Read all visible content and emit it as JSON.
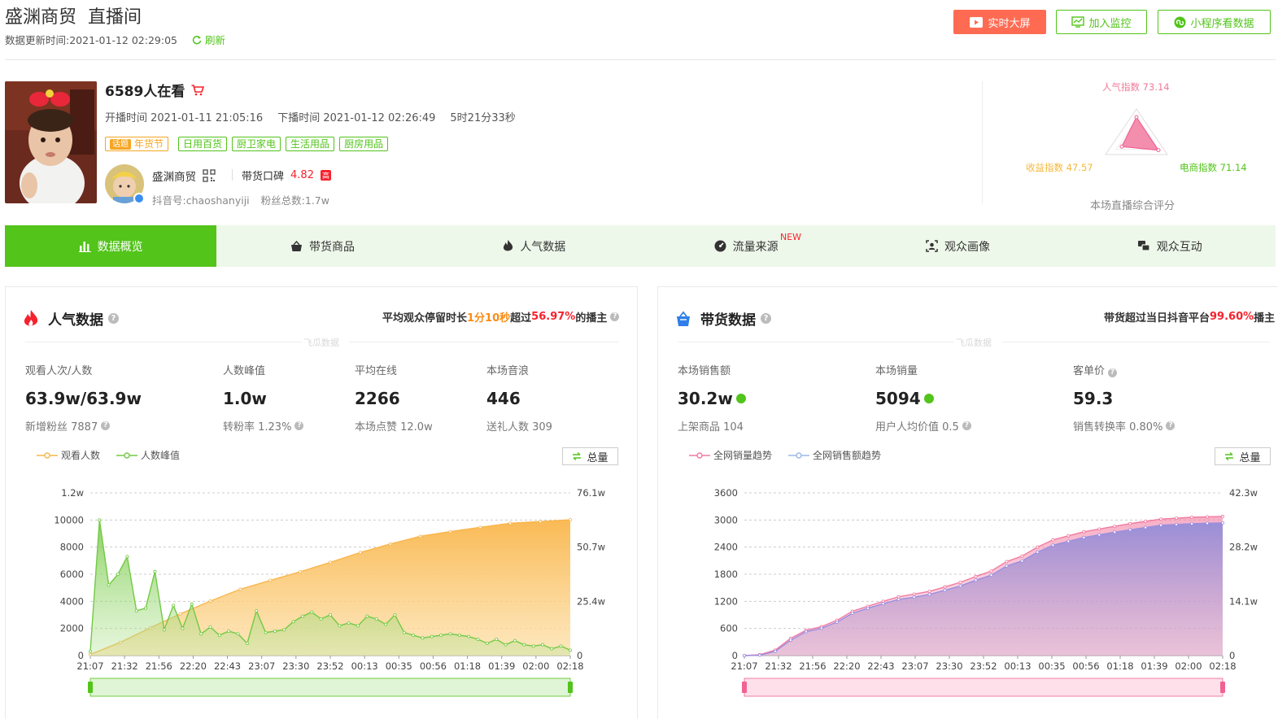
{
  "header": {
    "shop": "盛渊商贸",
    "room": "直播间",
    "update_label": "数据更新时间:",
    "update_time": "2021-01-12 02:29:05",
    "refresh": "刷新",
    "btn_screen": "实时大屏",
    "btn_monitor": "加入监控",
    "btn_mini": "小程序看数据"
  },
  "profile": {
    "viewers": "6589人在看",
    "start": "开播时间 2021-01-11 21:05:16",
    "end": "下播时间 2021-01-12 02:26:49",
    "duration": "5时21分33秒",
    "topic_badge": "话题",
    "topic": "年货节",
    "tags": [
      "日用百货",
      "厨卫家电",
      "生活用品",
      "厨房用品"
    ],
    "shop_name": "盛渊商贸",
    "koubei_label": "带货口碑",
    "koubei_score": "4.82",
    "koubei_level": "高",
    "douyin_id": "抖音号:chaoshanyiji",
    "fans": "粉丝总数:1.7w"
  },
  "radar": {
    "popularity": "人气指数 73.14",
    "income": "收益指数 47.57",
    "ecommerce": "电商指数 71.14",
    "caption": "本场直播综合评分",
    "values": [
      73.14,
      71.14,
      47.57
    ]
  },
  "tabs": [
    {
      "label": "数据概览",
      "icon": "bar-chart-icon"
    },
    {
      "label": "带货商品",
      "icon": "basket-icon"
    },
    {
      "label": "人气数据",
      "icon": "flame-icon"
    },
    {
      "label": "流量来源",
      "icon": "gauge-icon",
      "badge": "NEW"
    },
    {
      "label": "观众画像",
      "icon": "portrait-icon"
    },
    {
      "label": "观众互动",
      "icon": "chat-icon"
    }
  ],
  "popularity_panel": {
    "title": "人气数据",
    "summary_pre": "平均观众停留时长",
    "summary_time": "1分10秒",
    "summary_mid": " 超过",
    "summary_pct": "56.97%",
    "summary_post": "的播主",
    "watermark": "飞瓜数据",
    "metrics": [
      {
        "label": "观看人次/人数",
        "value": "63.9w/63.9w",
        "sub": "新增粉丝 7887"
      },
      {
        "label": "人数峰值",
        "value": "1.0w",
        "sub": "转粉率 1.23%"
      },
      {
        "label": "平均在线",
        "value": "2266",
        "sub": "本场点赞 12.0w"
      },
      {
        "label": "本场音浪",
        "value": "446",
        "sub": "送礼人数 309"
      }
    ],
    "legend": [
      "观看人数",
      "人数峰值"
    ],
    "total_btn": "总量"
  },
  "sales_panel": {
    "title": "带货数据",
    "summary_pre": "带货超过当日抖音平台",
    "summary_pct": "99.60%",
    "summary_post": "播主",
    "watermark": "飞瓜数据",
    "metrics": [
      {
        "label": "本场销售额",
        "value": "30.2w",
        "sub": "上架商品 104"
      },
      {
        "label": "本场销量",
        "value": "5094",
        "sub": "用户人均价值 0.5"
      },
      {
        "label": "客单价",
        "value": "59.3",
        "sub": "销售转换率 0.80%"
      }
    ],
    "legend": [
      "全网销量趋势",
      "全网销售额趋势"
    ],
    "total_btn": "总量"
  },
  "chart_data": [
    {
      "type": "area",
      "x": [
        "21:07",
        "21:32",
        "21:56",
        "22:20",
        "22:43",
        "23:07",
        "23:30",
        "23:52",
        "00:13",
        "00:35",
        "00:56",
        "01:18",
        "01:39",
        "02:00",
        "02:18"
      ],
      "y_left_ticks": [
        "0",
        "2000",
        "4000",
        "6000",
        "8000",
        "10000",
        "1.2w"
      ],
      "y_right_ticks": [
        "0",
        "25.4w",
        "50.7w",
        "76.1w"
      ],
      "ylim_left": [
        0,
        12000
      ],
      "ylim_right": [
        0,
        761000
      ],
      "series": [
        {
          "name": "观看人数",
          "axis": "right",
          "color": "#f9b64b",
          "values": [
            5000,
            62000,
            130000,
            195000,
            255000,
            310000,
            352000,
            392000,
            436000,
            482000,
            522000,
            558000,
            580000,
            600000,
            619000,
            627000,
            635000
          ]
        },
        {
          "name": "人数峰值",
          "axis": "left",
          "color": "#73c944",
          "values": [
            300,
            10000,
            5200,
            6000,
            7300,
            3300,
            3500,
            6200,
            1900,
            3700,
            2000,
            3800,
            1600,
            2100,
            1500,
            1800,
            1600,
            900,
            3300,
            1700,
            1800,
            1900,
            2500,
            2900,
            3200,
            2700,
            3000,
            2200,
            2400,
            2200,
            2900,
            2700,
            2300,
            3000,
            1700,
            1500,
            1300,
            1400,
            1500,
            1600,
            1500,
            1400,
            1200,
            900,
            1200,
            800,
            1100,
            800,
            700,
            800,
            500,
            700,
            400
          ]
        }
      ]
    },
    {
      "type": "area",
      "x": [
        "21:07",
        "21:32",
        "21:56",
        "22:20",
        "22:43",
        "23:07",
        "23:30",
        "23:52",
        "00:13",
        "00:35",
        "00:56",
        "01:18",
        "01:39",
        "02:00",
        "02:18"
      ],
      "y_left_ticks": [
        "0",
        "600",
        "1200",
        "1800",
        "2400",
        "3000",
        "3600"
      ],
      "y_right_ticks": [
        "0",
        "14.1w",
        "28.2w",
        "42.3w"
      ],
      "ylim_left": [
        0,
        3600
      ],
      "ylim_right": [
        0,
        423000
      ],
      "series": [
        {
          "name": "全网销量趋势",
          "axis": "left",
          "color": "#f27aa0",
          "values": [
            0,
            20,
            120,
            380,
            560,
            640,
            780,
            980,
            1090,
            1200,
            1300,
            1360,
            1420,
            1520,
            1620,
            1750,
            1870,
            2080,
            2200,
            2400,
            2560,
            2650,
            2740,
            2800,
            2860,
            2920,
            2970,
            3020,
            3040,
            3060,
            3070,
            3080
          ]
        },
        {
          "name": "全网销售额趋势",
          "axis": "right",
          "color": "#9b8ee0",
          "values": [
            0,
            1000,
            11000,
            40000,
            62000,
            71000,
            87000,
            110000,
            123000,
            135000,
            146000,
            152000,
            159000,
            170000,
            181000,
            196000,
            209000,
            233000,
            246000,
            269000,
            287000,
            297000,
            307000,
            314000,
            321000,
            327000,
            333000,
            339000,
            341000,
            343000,
            344000,
            345000
          ]
        }
      ]
    }
  ]
}
